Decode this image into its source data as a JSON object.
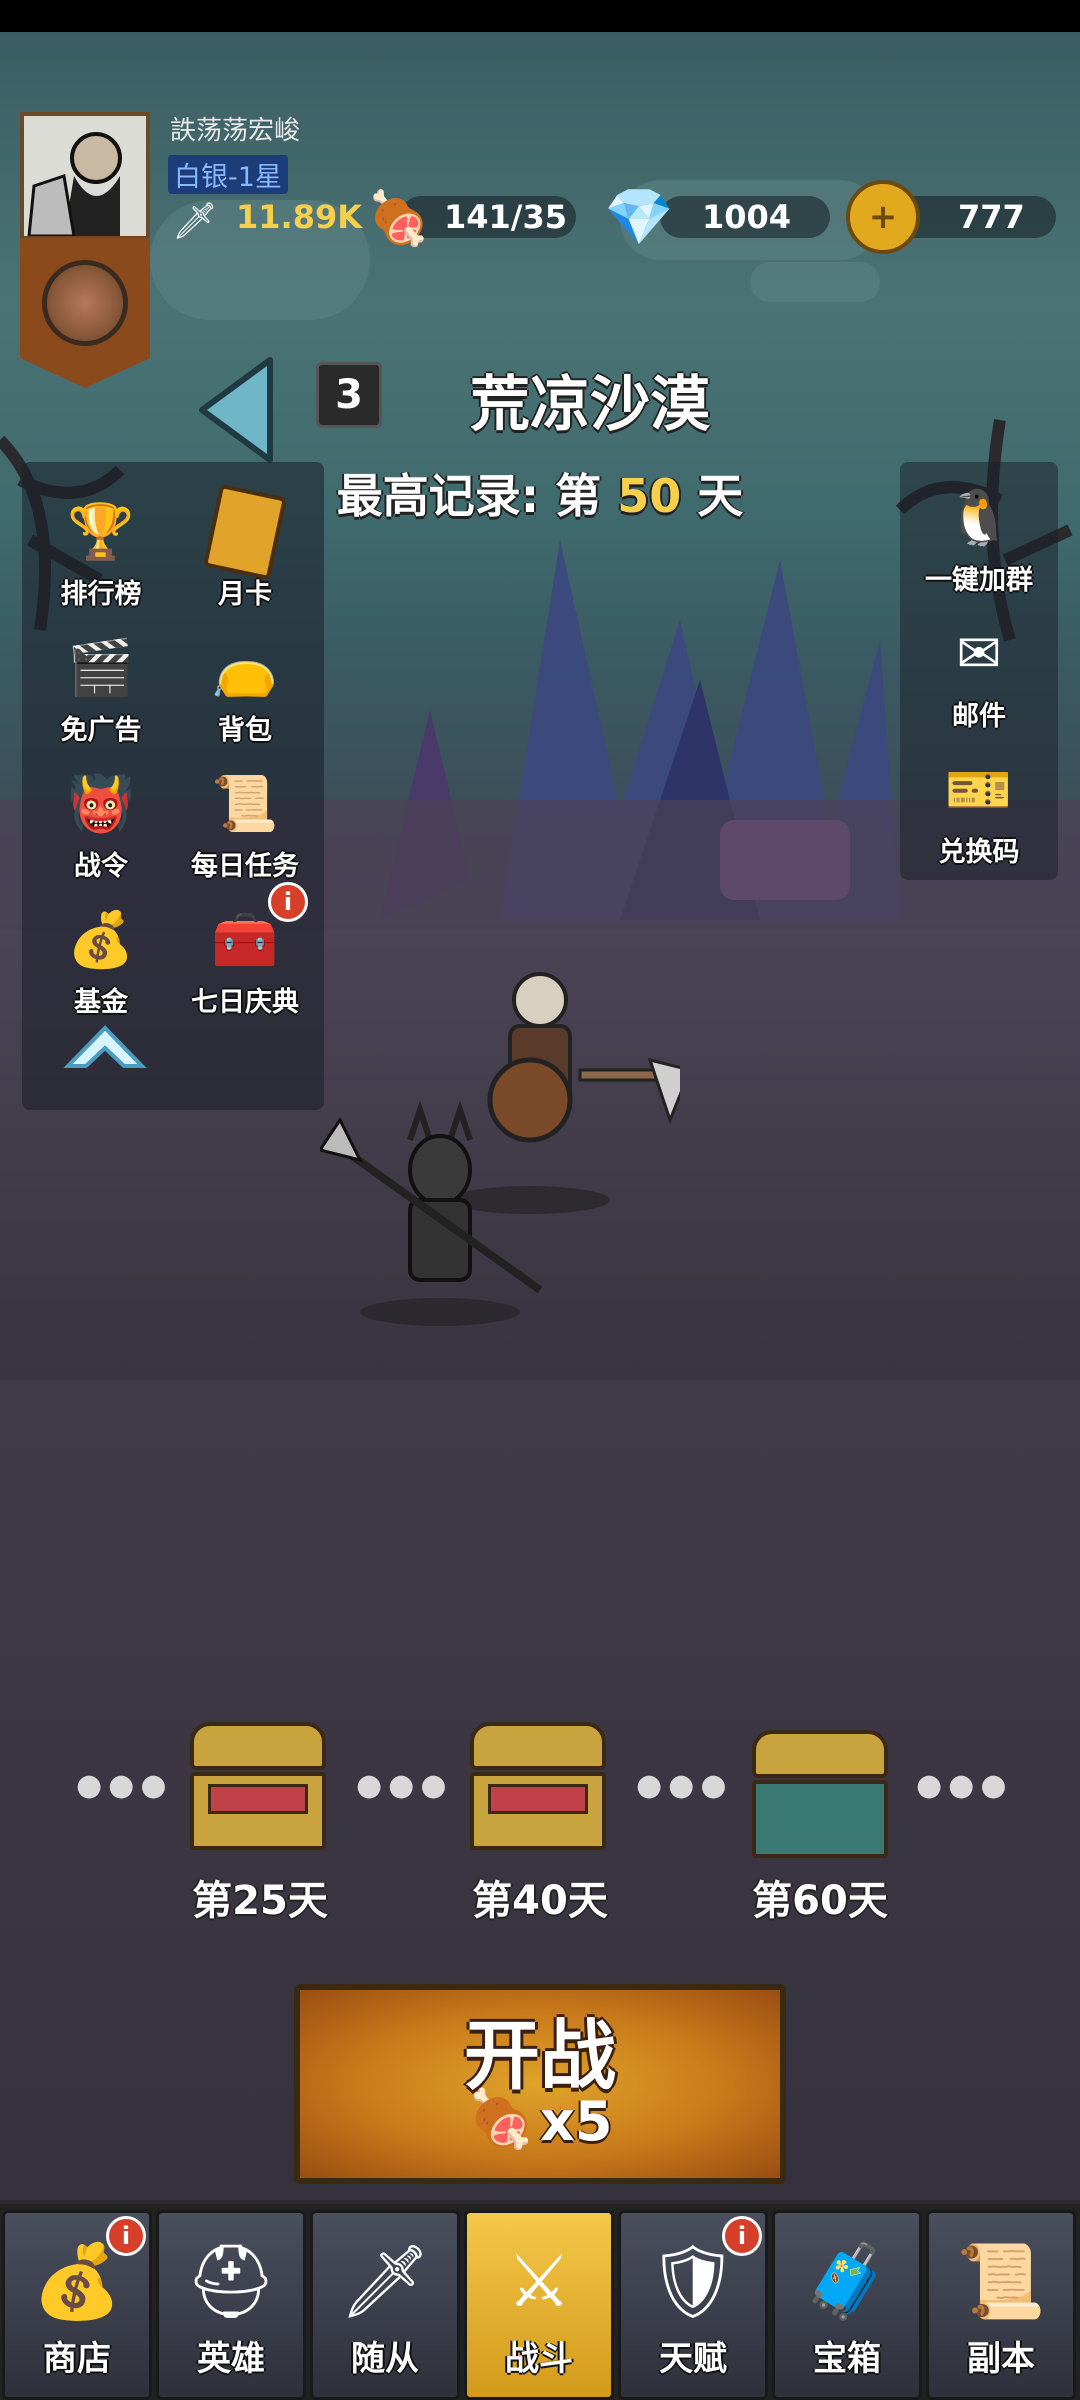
{
  "player": {
    "name": "詄荡荡宏峻",
    "rank": "白银-1星",
    "power": "11.89K",
    "stamina": "141/35",
    "gems": "1004",
    "gold": "777"
  },
  "stage": {
    "number": "3",
    "name": "荒凉沙漠",
    "record_prefix": "最高记录: 第",
    "record_day": "50",
    "record_suffix": "天"
  },
  "left_menu": [
    {
      "label": "排行榜",
      "icon": "trophy-icon"
    },
    {
      "label": "月卡",
      "icon": "month-card-icon"
    },
    {
      "label": "免广告",
      "icon": "no-ads-icon"
    },
    {
      "label": "背包",
      "icon": "bag-icon"
    },
    {
      "label": "战令",
      "icon": "battle-pass-icon"
    },
    {
      "label": "每日任务",
      "icon": "daily-task-icon"
    },
    {
      "label": "基金",
      "icon": "fund-icon"
    },
    {
      "label": "七日庆典",
      "icon": "seven-day-chest-icon",
      "badge": "i"
    }
  ],
  "right_menu": [
    {
      "label": "一键加群",
      "icon": "penguin-icon"
    },
    {
      "label": "邮件",
      "icon": "mail-icon"
    },
    {
      "label": "兑换码",
      "icon": "ticket-icon"
    }
  ],
  "milestones": [
    {
      "label": "第25天",
      "state": "open"
    },
    {
      "label": "第40天",
      "state": "open"
    },
    {
      "label": "第60天",
      "state": "closed"
    }
  ],
  "fight": {
    "label": "开战",
    "cost": "x5"
  },
  "nav": [
    {
      "label": "商店",
      "badge": "i",
      "icon": "shop-bag-icon"
    },
    {
      "label": "英雄",
      "icon": "helmet-icon"
    },
    {
      "label": "随从",
      "icon": "minion-icon"
    },
    {
      "label": "战斗",
      "icon": "crossed-swords-icon",
      "active": true
    },
    {
      "label": "天赋",
      "badge": "i",
      "icon": "talent-shield-icon"
    },
    {
      "label": "宝箱",
      "icon": "chest-icon"
    },
    {
      "label": "副本",
      "icon": "scroll-map-icon"
    }
  ],
  "colors": {
    "accent_gold": "#f6d04d",
    "rank_blue": "#8ab8ff",
    "badge_red": "#d6402a",
    "active_tab": "#f4c84a"
  }
}
